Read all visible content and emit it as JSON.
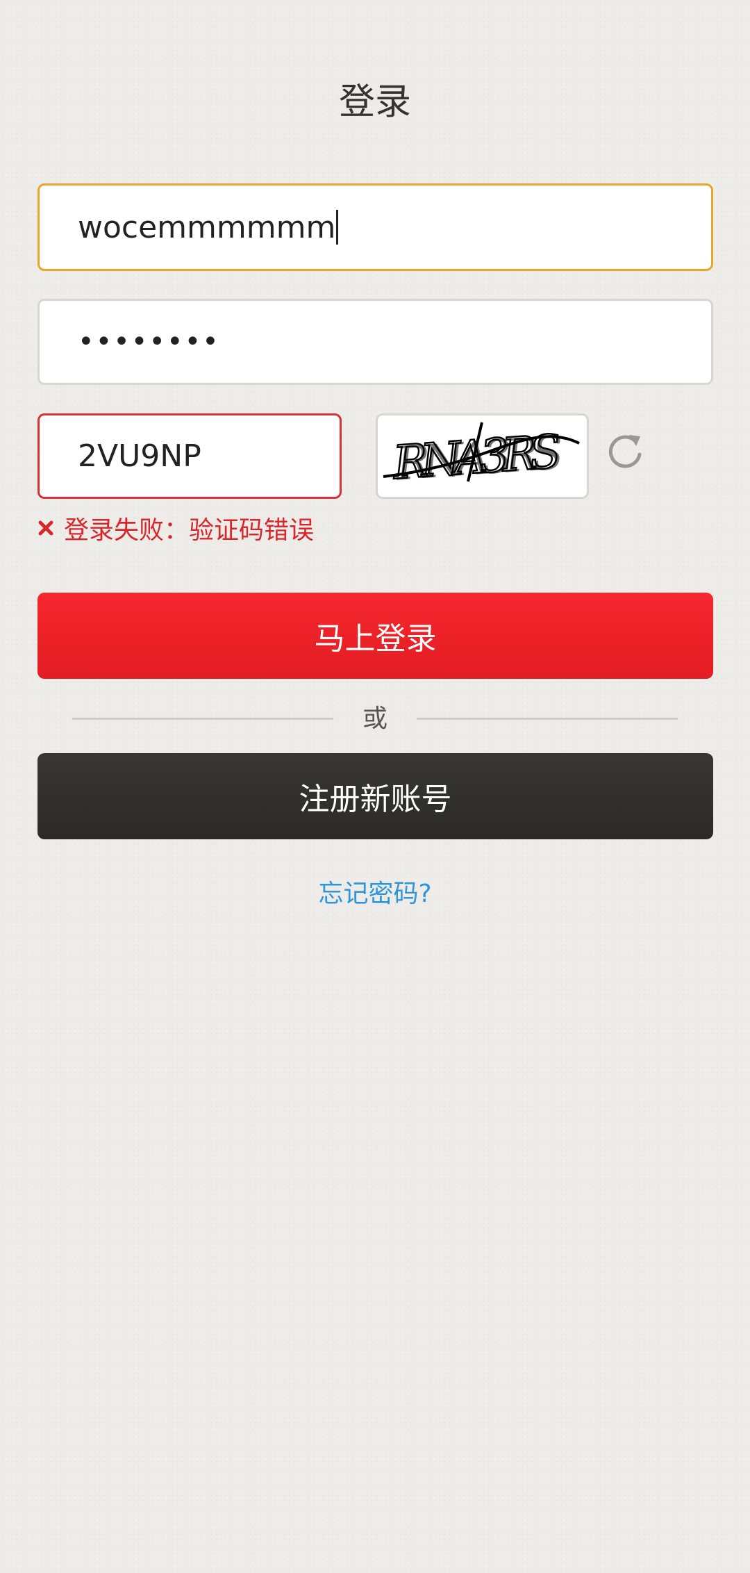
{
  "page": {
    "title": "登录"
  },
  "form": {
    "username_value": "wocemmmmmm",
    "password_value": "••••••••",
    "captcha_value": "2VU9NP",
    "captcha_image_text": "RNA3RS",
    "error_message": "登录失败：验证码错误"
  },
  "actions": {
    "login_label": "马上登录",
    "divider_label": "或",
    "register_label": "注册新账号",
    "forgot_label": "忘记密码?"
  },
  "icons": {
    "refresh": "refresh-icon",
    "error": "close-x-icon"
  },
  "colors": {
    "login_button": "#ed2128",
    "register_button": "#333130",
    "error": "#d7262c",
    "focus_border": "#e8a52a",
    "link": "#2e96d8"
  }
}
